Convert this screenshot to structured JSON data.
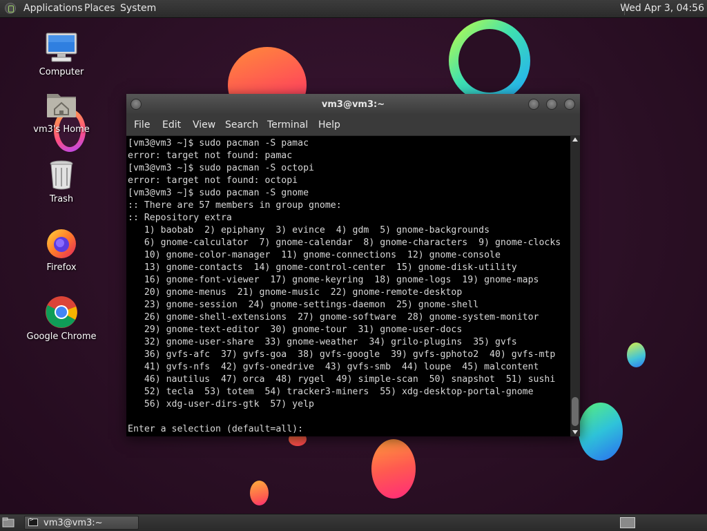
{
  "top_panel": {
    "menus": [
      "Applications",
      "Places",
      "System"
    ],
    "clock": "Wed Apr 3, 04:56"
  },
  "desktop": {
    "icons": [
      {
        "label": "Computer",
        "icon": "computer-icon"
      },
      {
        "label": "vm3's Home",
        "icon": "home-folder-icon"
      },
      {
        "label": "Trash",
        "icon": "trash-icon"
      },
      {
        "label": "Firefox",
        "icon": "firefox-icon"
      },
      {
        "label": "Google Chrome",
        "icon": "chrome-icon"
      }
    ]
  },
  "terminal": {
    "title": "vm3@vm3:~",
    "menu": [
      "File",
      "Edit",
      "View",
      "Search",
      "Terminal",
      "Help"
    ],
    "lines": [
      "[vm3@vm3 ~]$ sudo pacman -S pamac",
      "error: target not found: pamac",
      "[vm3@vm3 ~]$ sudo pacman -S octopi",
      "error: target not found: octopi",
      "[vm3@vm3 ~]$ sudo pacman -S gnome",
      ":: There are 57 members in group gnome:",
      ":: Repository extra",
      "   1) baobab  2) epiphany  3) evince  4) gdm  5) gnome-backgrounds",
      "   6) gnome-calculator  7) gnome-calendar  8) gnome-characters  9) gnome-clocks",
      "   10) gnome-color-manager  11) gnome-connections  12) gnome-console",
      "   13) gnome-contacts  14) gnome-control-center  15) gnome-disk-utility",
      "   16) gnome-font-viewer  17) gnome-keyring  18) gnome-logs  19) gnome-maps",
      "   20) gnome-menus  21) gnome-music  22) gnome-remote-desktop",
      "   23) gnome-session  24) gnome-settings-daemon  25) gnome-shell",
      "   26) gnome-shell-extensions  27) gnome-software  28) gnome-system-monitor",
      "   29) gnome-text-editor  30) gnome-tour  31) gnome-user-docs",
      "   32) gnome-user-share  33) gnome-weather  34) grilo-plugins  35) gvfs",
      "   36) gvfs-afc  37) gvfs-goa  38) gvfs-google  39) gvfs-gphoto2  40) gvfs-mtp",
      "   41) gvfs-nfs  42) gvfs-onedrive  43) gvfs-smb  44) loupe  45) malcontent",
      "   46) nautilus  47) orca  48) rygel  49) simple-scan  50) snapshot  51) sushi",
      "   52) tecla  53) totem  54) tracker3-miners  55) xdg-desktop-portal-gnome",
      "   56) xdg-user-dirs-gtk  57) yelp",
      "",
      "Enter a selection (default=all):"
    ]
  },
  "taskbar": {
    "window_button": "vm3@vm3:~"
  }
}
